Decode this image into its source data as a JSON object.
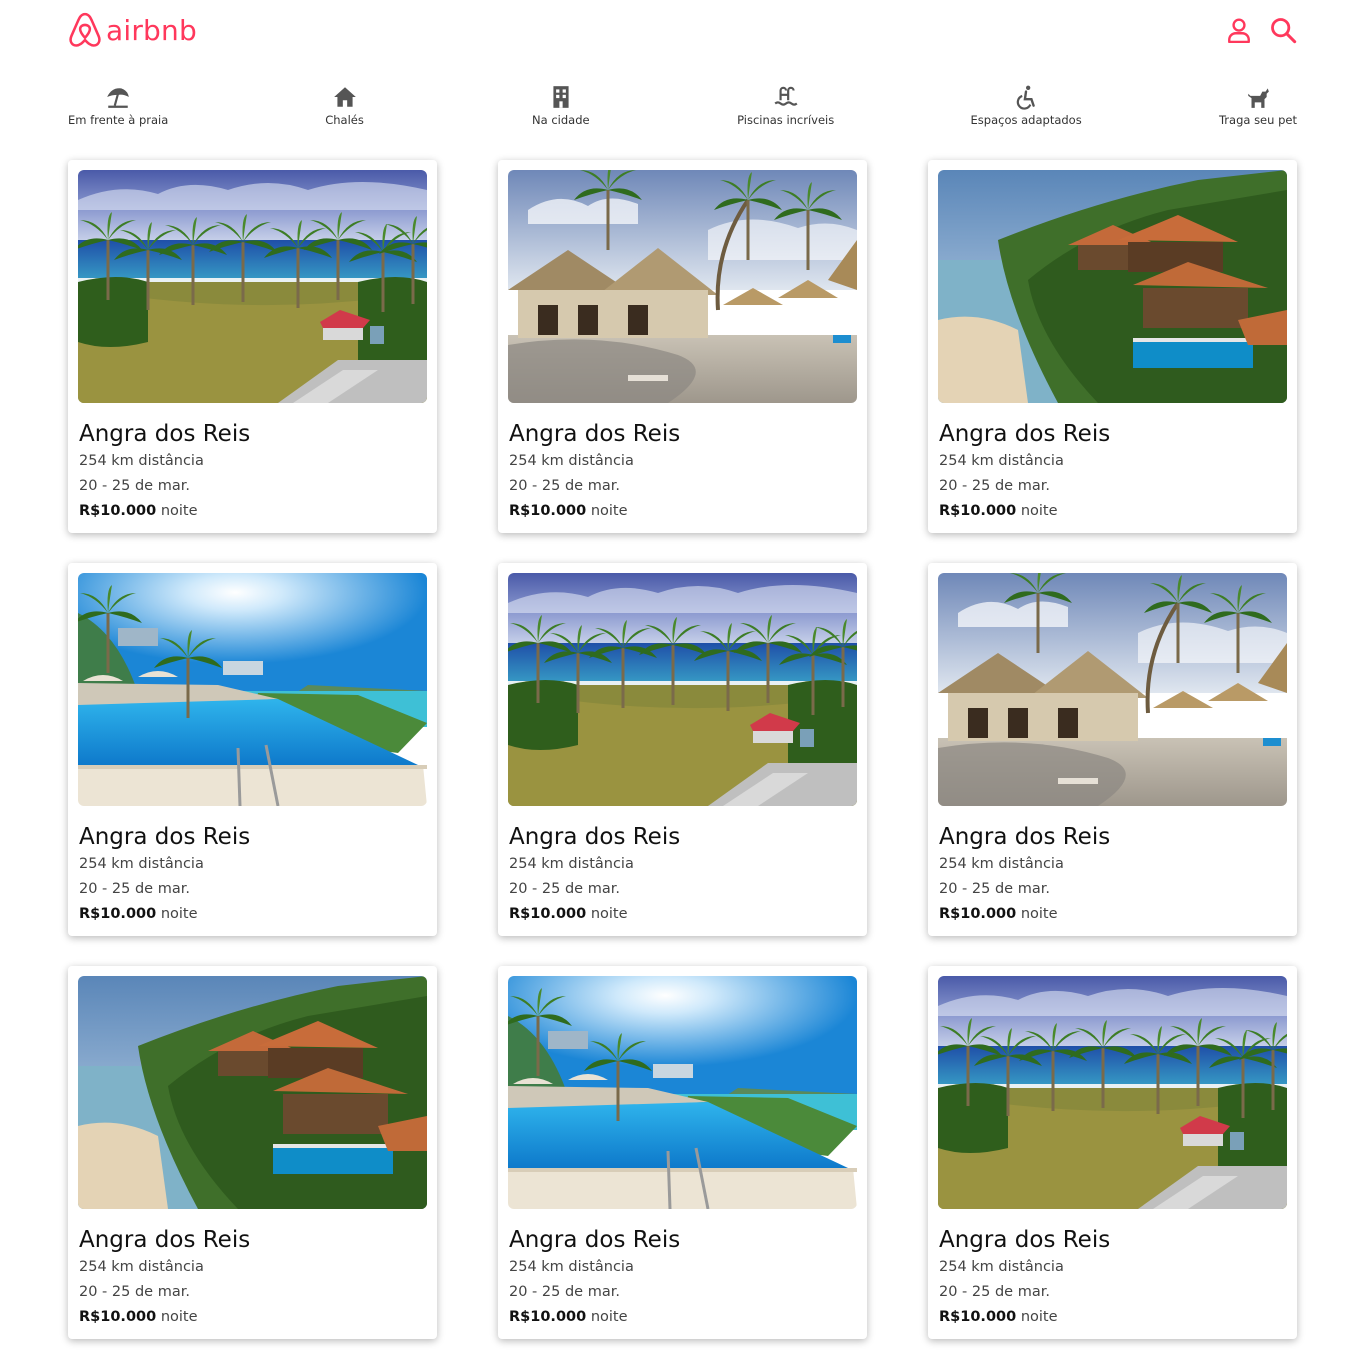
{
  "brand": {
    "name": "airbnb",
    "color": "#ff385c"
  },
  "header": {
    "user_icon": "user-icon",
    "search_icon": "search-icon"
  },
  "categories": [
    {
      "label": "Em frente à praia",
      "icon": "beach-umbrella-icon"
    },
    {
      "label": "Chalés",
      "icon": "house-icon"
    },
    {
      "label": "Na cidade",
      "icon": "building-icon"
    },
    {
      "label": "Piscinas incríveis",
      "icon": "pool-icon"
    },
    {
      "label": "Espaços adaptados",
      "icon": "wheelchair-icon"
    },
    {
      "label": "Traga seu pet",
      "icon": "dog-icon"
    }
  ],
  "listings": [
    {
      "title": "Angra dos Reis",
      "distance": "254 km distância",
      "dates": "20 - 25 de mar.",
      "price": "R$10.000",
      "price_unit": "noite",
      "photo": "palm-beach-aerial"
    },
    {
      "title": "Angra dos Reis",
      "distance": "254 km distância",
      "dates": "20 - 25 de mar.",
      "price": "R$10.000",
      "price_unit": "noite",
      "photo": "thatched-resort-beach"
    },
    {
      "title": "Angra dos Reis",
      "distance": "254 km distância",
      "dates": "20 - 25 de mar.",
      "price": "R$10.000",
      "price_unit": "noite",
      "photo": "hillside-villa-pool"
    },
    {
      "title": "Angra dos Reis",
      "distance": "254 km distância",
      "dates": "20 - 25 de mar.",
      "price": "R$10.000",
      "price_unit": "noite",
      "photo": "infinity-pool-sea"
    },
    {
      "title": "Angra dos Reis",
      "distance": "254 km distância",
      "dates": "20 - 25 de mar.",
      "price": "R$10.000",
      "price_unit": "noite",
      "photo": "palm-beach-aerial"
    },
    {
      "title": "Angra dos Reis",
      "distance": "254 km distância",
      "dates": "20 - 25 de mar.",
      "price": "R$10.000",
      "price_unit": "noite",
      "photo": "thatched-resort-beach"
    },
    {
      "title": "Angra dos Reis",
      "distance": "254 km distância",
      "dates": "20 - 25 de mar.",
      "price": "R$10.000",
      "price_unit": "noite",
      "photo": "hillside-villa-pool"
    },
    {
      "title": "Angra dos Reis",
      "distance": "254 km distância",
      "dates": "20 - 25 de mar.",
      "price": "R$10.000",
      "price_unit": "noite",
      "photo": "infinity-pool-sea"
    },
    {
      "title": "Angra dos Reis",
      "distance": "254 km distância",
      "dates": "20 - 25 de mar.",
      "price": "R$10.000",
      "price_unit": "noite",
      "photo": "palm-beach-aerial"
    }
  ]
}
